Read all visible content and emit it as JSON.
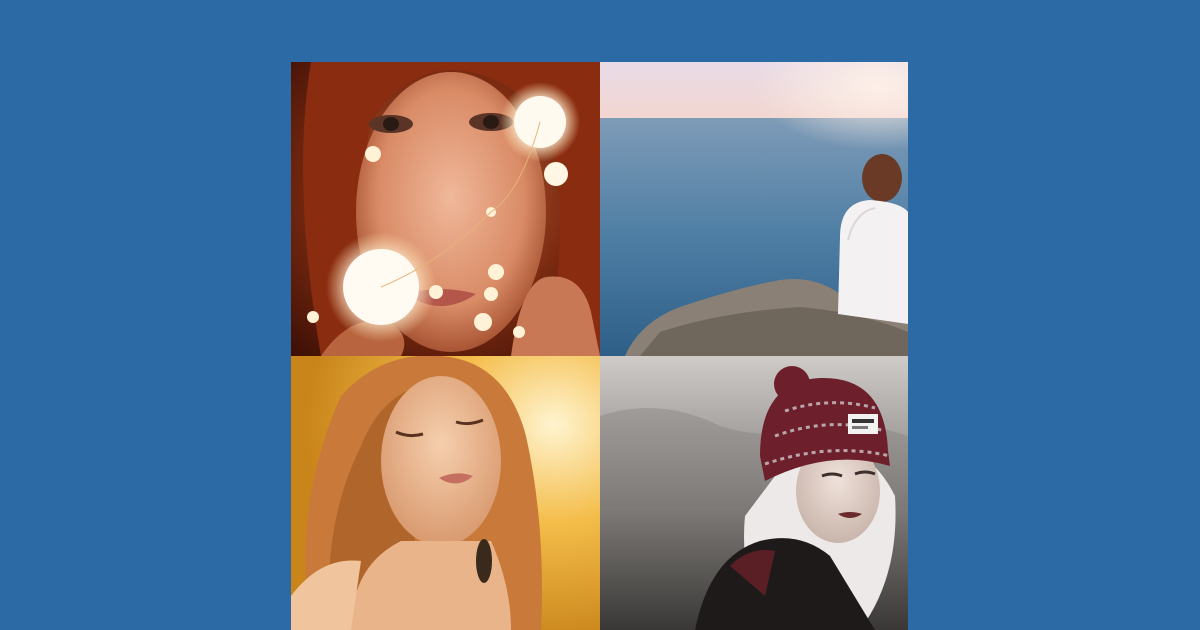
{
  "colors": {
    "background": "#2b6aa5"
  },
  "photos": [
    {
      "subject": "woman-with-fairy-lights-photo"
    },
    {
      "subject": "woman-sitting-on-sea-cliff-photo"
    },
    {
      "subject": "woman-in-golden-light-photo"
    },
    {
      "subject": "woman-in-knit-beanie-photo"
    }
  ]
}
